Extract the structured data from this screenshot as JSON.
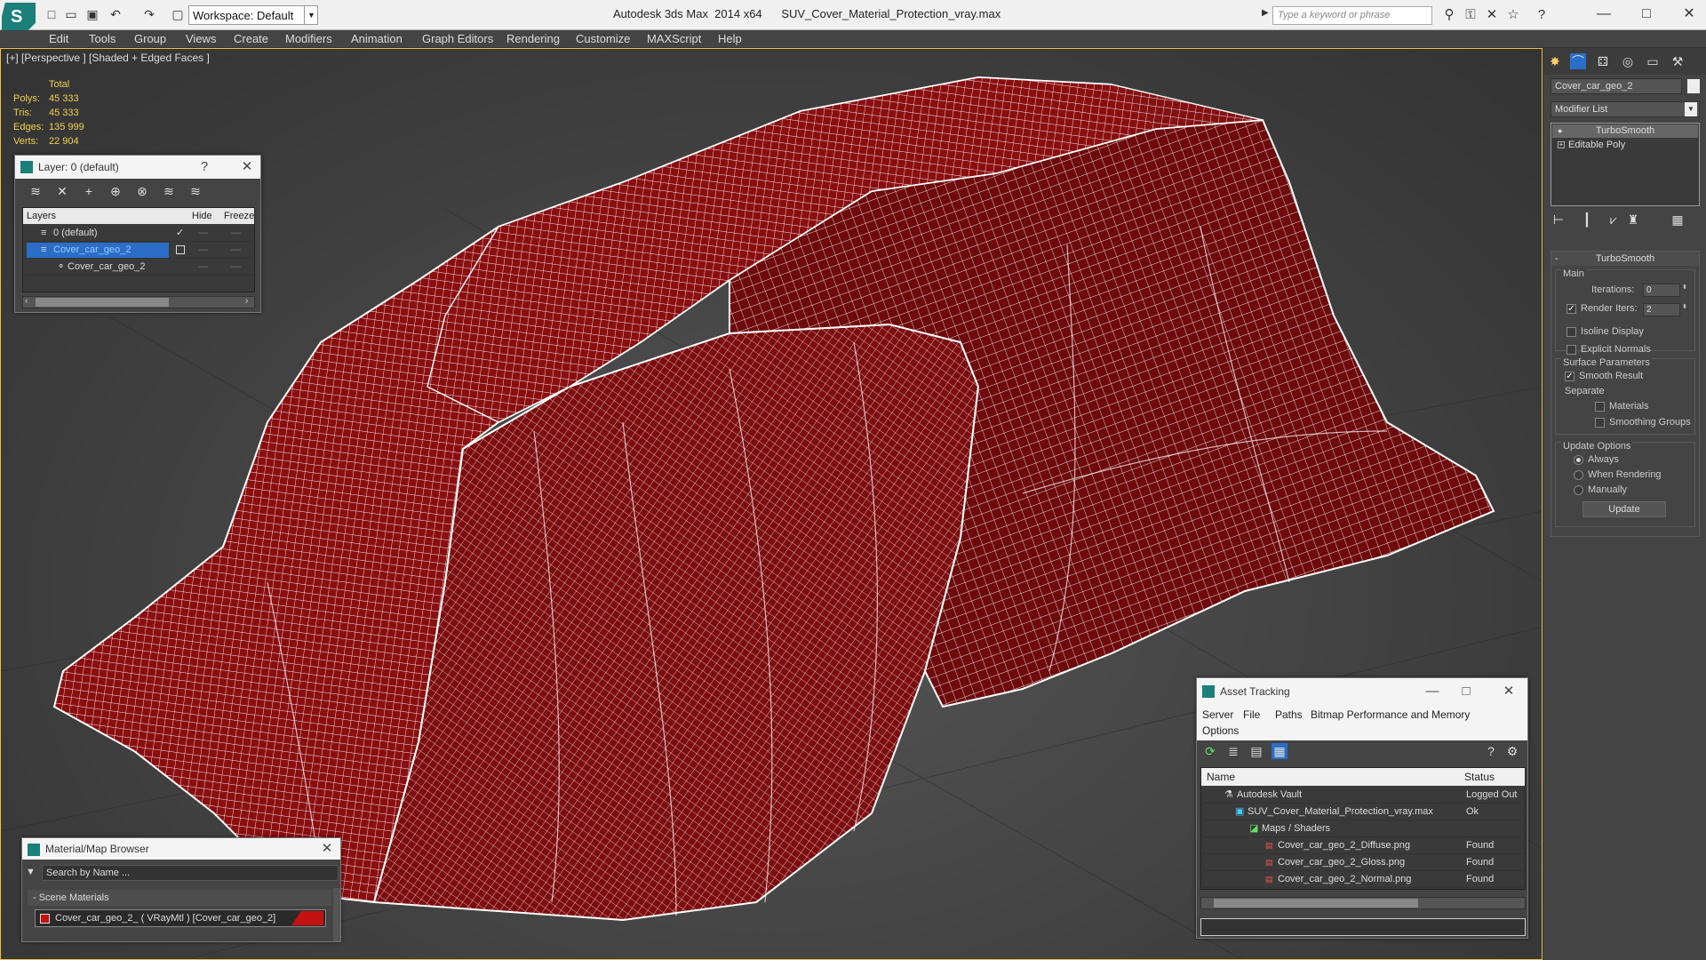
{
  "window": {
    "title": "Autodesk 3ds Max  2014 x64      SUV_Cover_Material_Protection_vray.max",
    "workspace": "Workspace: Default",
    "search_placeholder": "Type a keyword or phrase"
  },
  "menu": [
    "Edit",
    "Tools",
    "Group",
    "Views",
    "Create",
    "Modifiers",
    "Animation",
    "Graph Editors",
    "Rendering",
    "Customize",
    "MAXScript",
    "Help"
  ],
  "viewport": {
    "label": "[+] [Perspective ] [Shaded + Edged Faces ]",
    "stats": {
      "header": "Total",
      "polys_label": "Polys:",
      "polys": "45 333",
      "tris_label": "Tris:",
      "tris": "45 333",
      "edges_label": "Edges:",
      "edges": "135 999",
      "verts_label": "Verts:",
      "verts": "22 904"
    },
    "colors": {
      "mesh": "#8a0e10",
      "wire": "#ffffff"
    }
  },
  "layer_panel": {
    "title": "Layer: 0 (default)",
    "help": "?",
    "col_layers": "Layers",
    "col_hide": "Hide",
    "col_freeze": "Freeze",
    "rows": [
      {
        "name": "0 (default)"
      },
      {
        "name": "Cover_car_geo_2"
      },
      {
        "name": "Cover_car_geo_2"
      }
    ]
  },
  "material_browser": {
    "title": "Material/Map Browser",
    "search_placeholder": "Search by Name ...",
    "group": "- Scene Materials",
    "item": "Cover_car_geo_2_  ( VRayMtl ) [Cover_car_geo_2]",
    "swatch_color": "#c41212"
  },
  "asset_tracking": {
    "title": "Asset Tracking",
    "menu": [
      "Server",
      "File",
      "Paths",
      "Bitmap Performance and Memory"
    ],
    "menu2": "Options",
    "col_name": "Name",
    "col_status": "Status",
    "rows": [
      {
        "name": "Autodesk Vault",
        "status": "Logged Out"
      },
      {
        "name": "SUV_Cover_Material_Protection_vray.max",
        "status": "Ok"
      },
      {
        "name": "Maps / Shaders",
        "status": ""
      },
      {
        "name": "Cover_car_geo_2_Diffuse.png",
        "status": "Found"
      },
      {
        "name": "Cover_car_geo_2_Gloss.png",
        "status": "Found"
      },
      {
        "name": "Cover_car_geo_2_Normal.png",
        "status": "Found"
      }
    ]
  },
  "command_panel": {
    "object_name": "Cover_car_geo_2",
    "modifier_list": "Modifier List",
    "stack": [
      "TurboSmooth",
      "Editable Poly"
    ],
    "turbosmooth": {
      "title": "TurboSmooth",
      "main": "Main",
      "iterations_label": "Iterations:",
      "iterations": "0",
      "render_iters_label": "Render Iters:",
      "render_iters": "2",
      "isoline": "Isoline Display",
      "explicit_normals": "Explicit Normals",
      "surface_params": "Surface Parameters",
      "smooth_result": "Smooth Result",
      "separate": "Separate",
      "materials": "Materials",
      "smoothing_groups": "Smoothing Groups",
      "update_options": "Update Options",
      "always": "Always",
      "when_rendering": "When Rendering",
      "manually": "Manually",
      "update": "Update"
    }
  }
}
